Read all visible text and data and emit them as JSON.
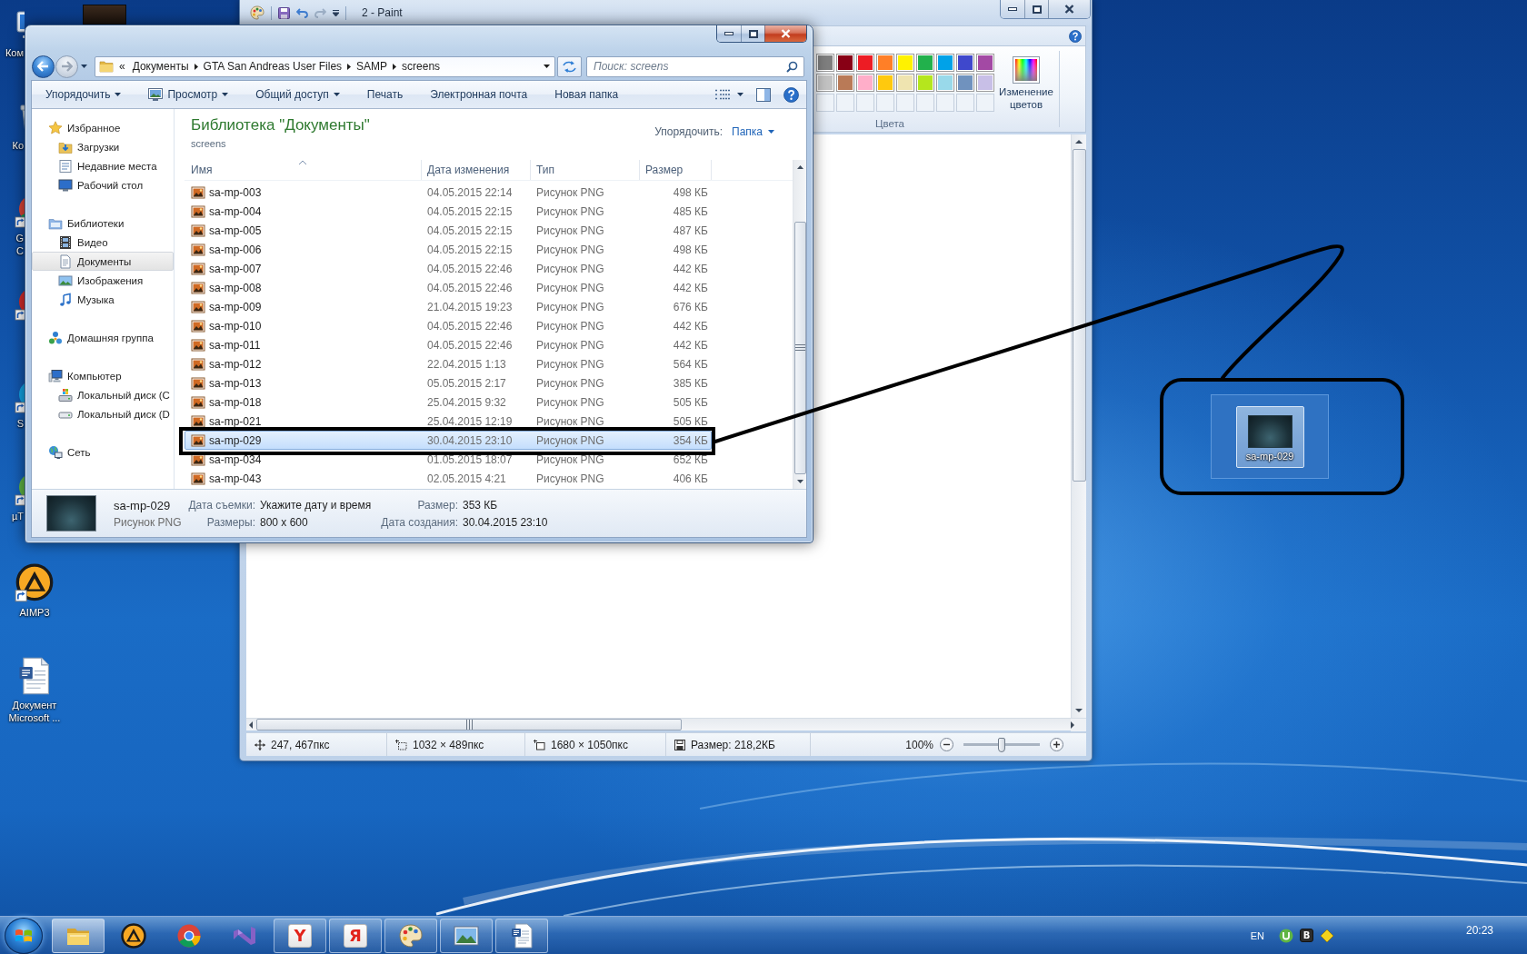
{
  "desktop": {
    "icons": [
      {
        "kind": "computer",
        "label_lines": [
          "Ком"
        ]
      },
      {
        "kind": "recycle-bin",
        "label_lines": [
          "Ко"
        ]
      },
      {
        "kind": "chrome",
        "label_lines": [
          "G",
          "C"
        ]
      },
      {
        "kind": "red-app"
      },
      {
        "kind": "skype",
        "label_lines": [
          "S"
        ]
      },
      {
        "kind": "utorrent",
        "label_lines": [
          "µT"
        ]
      },
      {
        "kind": "aimp",
        "label_lines": [
          "AIMP3"
        ]
      },
      {
        "kind": "word-doc",
        "label_lines": [
          "Документ",
          "Microsoft ..."
        ]
      }
    ],
    "top_icons": [
      {
        "kind": "image"
      }
    ]
  },
  "paint": {
    "title": "2 - Paint",
    "active": false,
    "colors_group": "Цвета",
    "edit_colors": "Изменение цветов",
    "palette": [
      {
        "kind": "swatch",
        "color": "#7f7f7f"
      },
      {
        "kind": "swatch",
        "color": "#880015"
      },
      {
        "kind": "swatch",
        "color": "#ed1c24"
      },
      {
        "kind": "swatch",
        "color": "#ff7f27"
      },
      {
        "kind": "swatch",
        "color": "#fff200"
      },
      {
        "kind": "swatch",
        "color": "#22b14c"
      },
      {
        "kind": "swatch",
        "color": "#00a2e8"
      },
      {
        "kind": "swatch",
        "color": "#3f48cc"
      },
      {
        "kind": "swatch",
        "color": "#a349a4"
      },
      {
        "kind": "swatch",
        "color": "#c3c3c3"
      },
      {
        "kind": "swatch",
        "color": "#b97a57"
      },
      {
        "kind": "swatch",
        "color": "#ffaec9"
      },
      {
        "kind": "swatch",
        "color": "#ffc90e"
      },
      {
        "kind": "swatch",
        "color": "#efe4b0"
      },
      {
        "kind": "swatch",
        "color": "#b5e61d"
      },
      {
        "kind": "swatch",
        "color": "#99d9ea"
      },
      {
        "kind": "swatch",
        "color": "#7092be"
      },
      {
        "kind": "swatch",
        "color": "#c8bfe7"
      },
      {
        "kind": "empty"
      },
      {
        "kind": "empty"
      },
      {
        "kind": "empty"
      },
      {
        "kind": "empty"
      },
      {
        "kind": "empty"
      },
      {
        "kind": "empty"
      },
      {
        "kind": "empty"
      },
      {
        "kind": "empty"
      },
      {
        "kind": "empty"
      }
    ],
    "status": {
      "cursor": "247, 467пкс",
      "selection": "1032 × 489пкс",
      "canvas": "1680 × 1050пкс",
      "file_size": "Размер: 218,2КБ",
      "zoom": "100%",
      "zoom_slider": {
        "level": 0.5
      }
    }
  },
  "explorer": {
    "active": true,
    "nav_buttons": [
      {
        "kind": "back",
        "disabled": false
      },
      {
        "kind": "forward",
        "disabled": true
      }
    ],
    "address": {
      "overflow": "«",
      "crumbs": [
        "Документы",
        "GTA San Andreas User Files",
        "SAMP",
        "screens"
      ]
    },
    "search": {
      "placeholder": "Поиск: screens"
    },
    "toolbar": [
      {
        "label": "Упорядочить",
        "kind": "menu"
      },
      {
        "label": "Просмотр",
        "kind": "icon-menu"
      },
      {
        "label": "Общий доступ",
        "kind": "menu"
      },
      {
        "label": "Печать",
        "kind": "plain"
      },
      {
        "label": "Электронная почта",
        "kind": "plain"
      },
      {
        "label": "Новая папка",
        "kind": "plain"
      }
    ],
    "nav": [
      {
        "label": "Избранное",
        "kind": "favorites",
        "selected": false,
        "children": [
          {
            "label": "Загрузки",
            "kind": "downloads",
            "selected": false
          },
          {
            "label": "Недавние места",
            "kind": "recent",
            "selected": false
          },
          {
            "label": "Рабочий стол",
            "kind": "desktop",
            "selected": false
          }
        ]
      },
      {
        "label": "Библиотеки",
        "kind": "libraries",
        "selected": false,
        "children": [
          {
            "label": "Видео",
            "kind": "video",
            "selected": false
          },
          {
            "label": "Документы",
            "kind": "documents",
            "selected": true
          },
          {
            "label": "Изображения",
            "kind": "pictures",
            "selected": false
          },
          {
            "label": "Музыка",
            "kind": "music",
            "selected": false
          }
        ]
      },
      {
        "label": "Домашняя группа",
        "kind": "homegroup",
        "selected": false
      },
      {
        "label": "Компьютер",
        "kind": "computer",
        "selected": false,
        "children": [
          {
            "label": "Локальный диск (C",
            "kind": "system-drive",
            "selected": false
          },
          {
            "label": "Локальный диск (D",
            "kind": "drive",
            "selected": false
          }
        ]
      },
      {
        "label": "Сеть",
        "kind": "network",
        "selected": false
      }
    ],
    "library": {
      "title": "Библиотека \"Документы\"",
      "subtitle": "screens",
      "arrange_label": "Упорядочить:",
      "arrange_value": "Папка"
    },
    "columns": [
      {
        "label": "Имя",
        "sorted": true
      },
      {
        "label": "Дата изменения",
        "sorted": false
      },
      {
        "label": "Тип",
        "sorted": false
      },
      {
        "label": "Размер",
        "sorted": false
      }
    ],
    "rows": [
      {
        "name": "sa-mp-003",
        "date": "04.05.2015 22:14",
        "type": "Рисунок PNG",
        "size": "498 КБ",
        "selected": false
      },
      {
        "name": "sa-mp-004",
        "date": "04.05.2015 22:15",
        "type": "Рисунок PNG",
        "size": "485 КБ",
        "selected": false
      },
      {
        "name": "sa-mp-005",
        "date": "04.05.2015 22:15",
        "type": "Рисунок PNG",
        "size": "487 КБ",
        "selected": false
      },
      {
        "name": "sa-mp-006",
        "date": "04.05.2015 22:15",
        "type": "Рисунок PNG",
        "size": "498 КБ",
        "selected": false
      },
      {
        "name": "sa-mp-007",
        "date": "04.05.2015 22:46",
        "type": "Рисунок PNG",
        "size": "442 КБ",
        "selected": false
      },
      {
        "name": "sa-mp-008",
        "date": "04.05.2015 22:46",
        "type": "Рисунок PNG",
        "size": "442 КБ",
        "selected": false
      },
      {
        "name": "sa-mp-009",
        "date": "21.04.2015 19:23",
        "type": "Рисунок PNG",
        "size": "676 КБ",
        "selected": false
      },
      {
        "name": "sa-mp-010",
        "date": "04.05.2015 22:46",
        "type": "Рисунок PNG",
        "size": "442 КБ",
        "selected": false
      },
      {
        "name": "sa-mp-011",
        "date": "04.05.2015 22:46",
        "type": "Рисунок PNG",
        "size": "442 КБ",
        "selected": false
      },
      {
        "name": "sa-mp-012",
        "date": "22.04.2015 1:13",
        "type": "Рисунок PNG",
        "size": "564 КБ",
        "selected": false
      },
      {
        "name": "sa-mp-013",
        "date": "05.05.2015 2:17",
        "type": "Рисунок PNG",
        "size": "385 КБ",
        "selected": false
      },
      {
        "name": "sa-mp-018",
        "date": "25.04.2015 9:32",
        "type": "Рисунок PNG",
        "size": "505 КБ",
        "selected": false
      },
      {
        "name": "sa-mp-021",
        "date": "25.04.2015 12:19",
        "type": "Рисунок PNG",
        "size": "505 КБ",
        "selected": false
      },
      {
        "name": "sa-mp-029",
        "date": "30.04.2015 23:10",
        "type": "Рисунок PNG",
        "size": "354 КБ",
        "selected": true
      },
      {
        "name": "sa-mp-034",
        "date": "01.05.2015 18:07",
        "type": "Рисунок PNG",
        "size": "652 КБ",
        "selected": false
      },
      {
        "name": "sa-mp-043",
        "date": "02.05.2015 4:21",
        "type": "Рисунок PNG",
        "size": "406 КБ",
        "selected": false
      }
    ],
    "details": {
      "name": "sa-mp-029",
      "type": "Рисунок PNG",
      "fields": [
        {
          "label": "Дата съемки:",
          "value": "Укажите дату и время"
        },
        {
          "label": "Размер:",
          "value": "353 КБ"
        },
        {
          "label": "Размеры:",
          "value": "800 x 600"
        },
        {
          "label": "Дата создания:",
          "value": "30.04.2015 23:10"
        }
      ]
    }
  },
  "annotation": {
    "drag_label": "sa-mp-029"
  },
  "taskbar": {
    "items": [
      {
        "kind": "explorer",
        "running": true,
        "selected": true
      },
      {
        "kind": "aimp",
        "running": false,
        "selected": false
      },
      {
        "kind": "chrome",
        "running": false,
        "selected": false
      },
      {
        "kind": "visual-studio",
        "running": false,
        "selected": false
      },
      {
        "kind": "letter-tile",
        "glyph": "Y",
        "running": true,
        "selected": false
      },
      {
        "kind": "letter-tile",
        "glyph": "Я",
        "running": true,
        "selected": false
      },
      {
        "kind": "paint",
        "running": true,
        "selected": false
      },
      {
        "kind": "photo-viewer",
        "running": true,
        "selected": false
      },
      {
        "kind": "word",
        "running": true,
        "selected": false
      }
    ],
    "language": "EN",
    "tray": [
      {
        "kind": "round-logo"
      },
      {
        "kind": "letter-tile",
        "glyph": "B"
      },
      {
        "kind": "diamond"
      }
    ],
    "clock": "20:23"
  }
}
